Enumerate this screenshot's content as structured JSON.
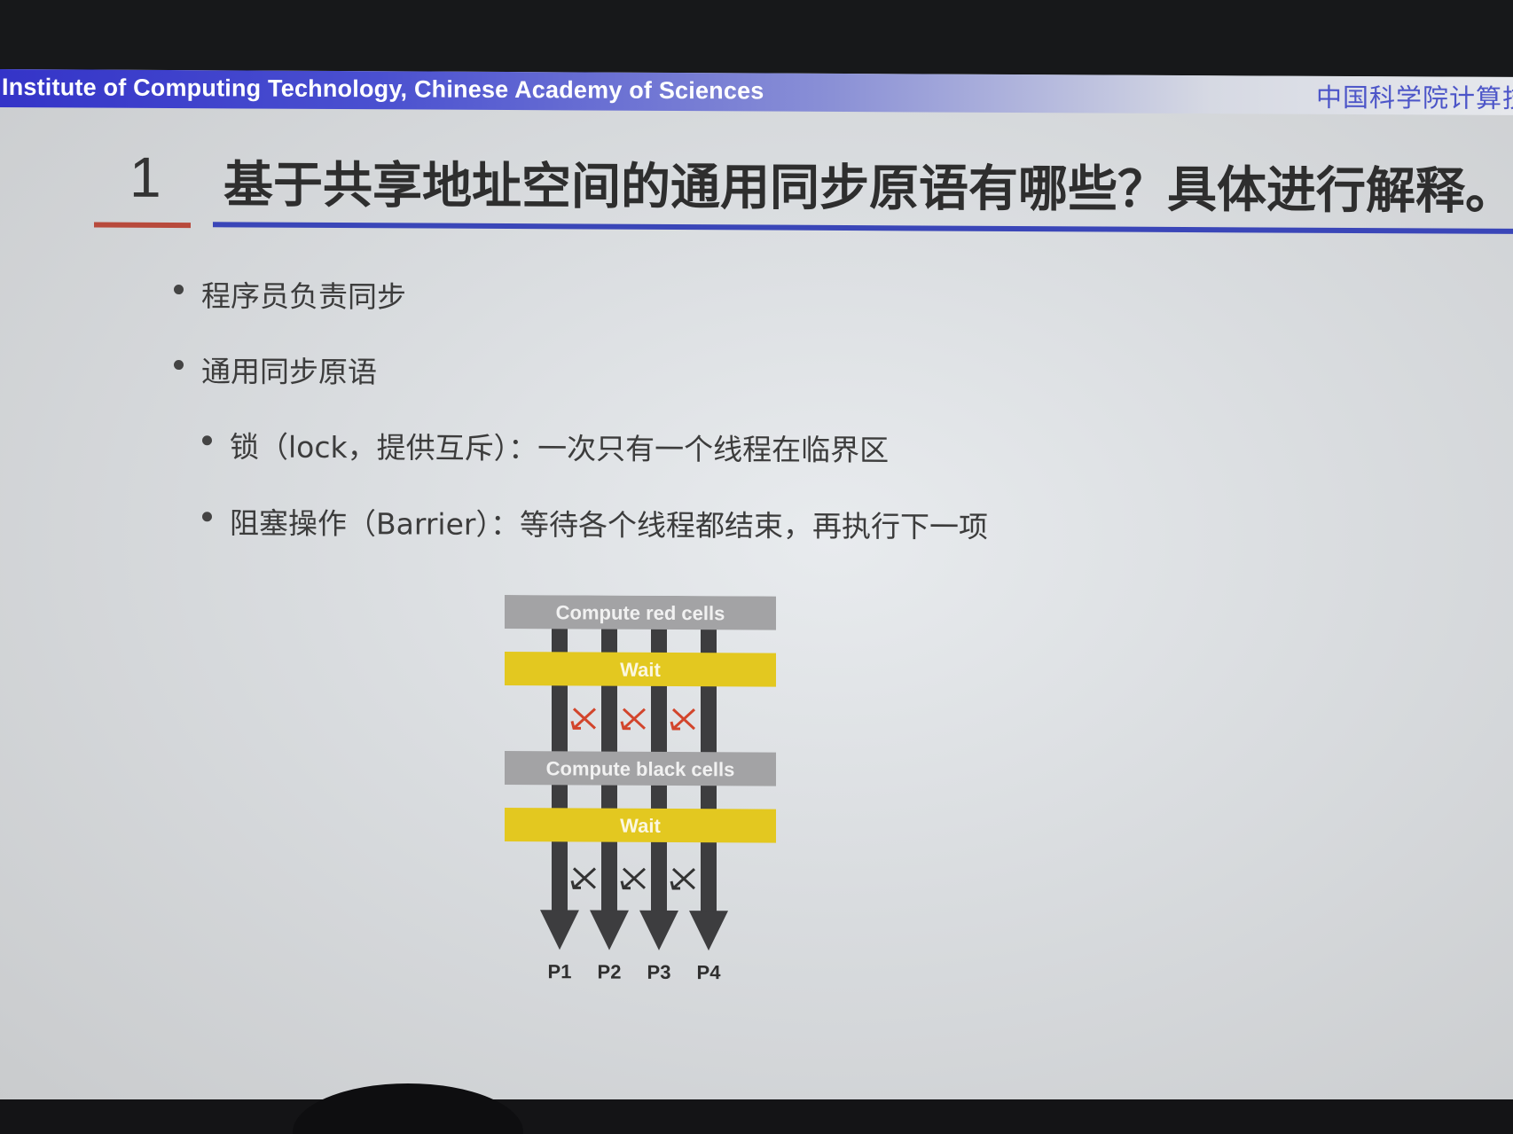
{
  "header": {
    "left_text": "Institute of Computing Technology, Chinese Academy of Sciences",
    "right_text": "中国科学院计算技"
  },
  "slide": {
    "number": "1",
    "title": "基于共享地址空间的通用同步原语有哪些？具体进行解释。"
  },
  "bullets": [
    {
      "level": 1,
      "text": "程序员负责同步"
    },
    {
      "level": 1,
      "text": "通用同步原语"
    },
    {
      "level": 2,
      "text": "锁（lock，提供互斥）：一次只有一个线程在临界区"
    },
    {
      "level": 2,
      "text": "阻塞操作（Barrier）：等待各个线程都结束，再执行下一项"
    }
  ],
  "diagram": {
    "bars": [
      "Compute red cells",
      "Wait",
      "Compute black cells",
      "Wait"
    ],
    "processors": [
      "P1",
      "P2",
      "P3",
      "P4"
    ],
    "colors": {
      "compute_bar": "#a3a3a5",
      "wait_bar": "#e3c820",
      "thread_line": "#3d3d3f",
      "red_cross": "#d2452c",
      "black_cross": "#333333"
    }
  },
  "colors": {
    "header_blue": "#3434c8",
    "title_underline": "#3a46b8",
    "number_underline": "#b84a3c"
  }
}
